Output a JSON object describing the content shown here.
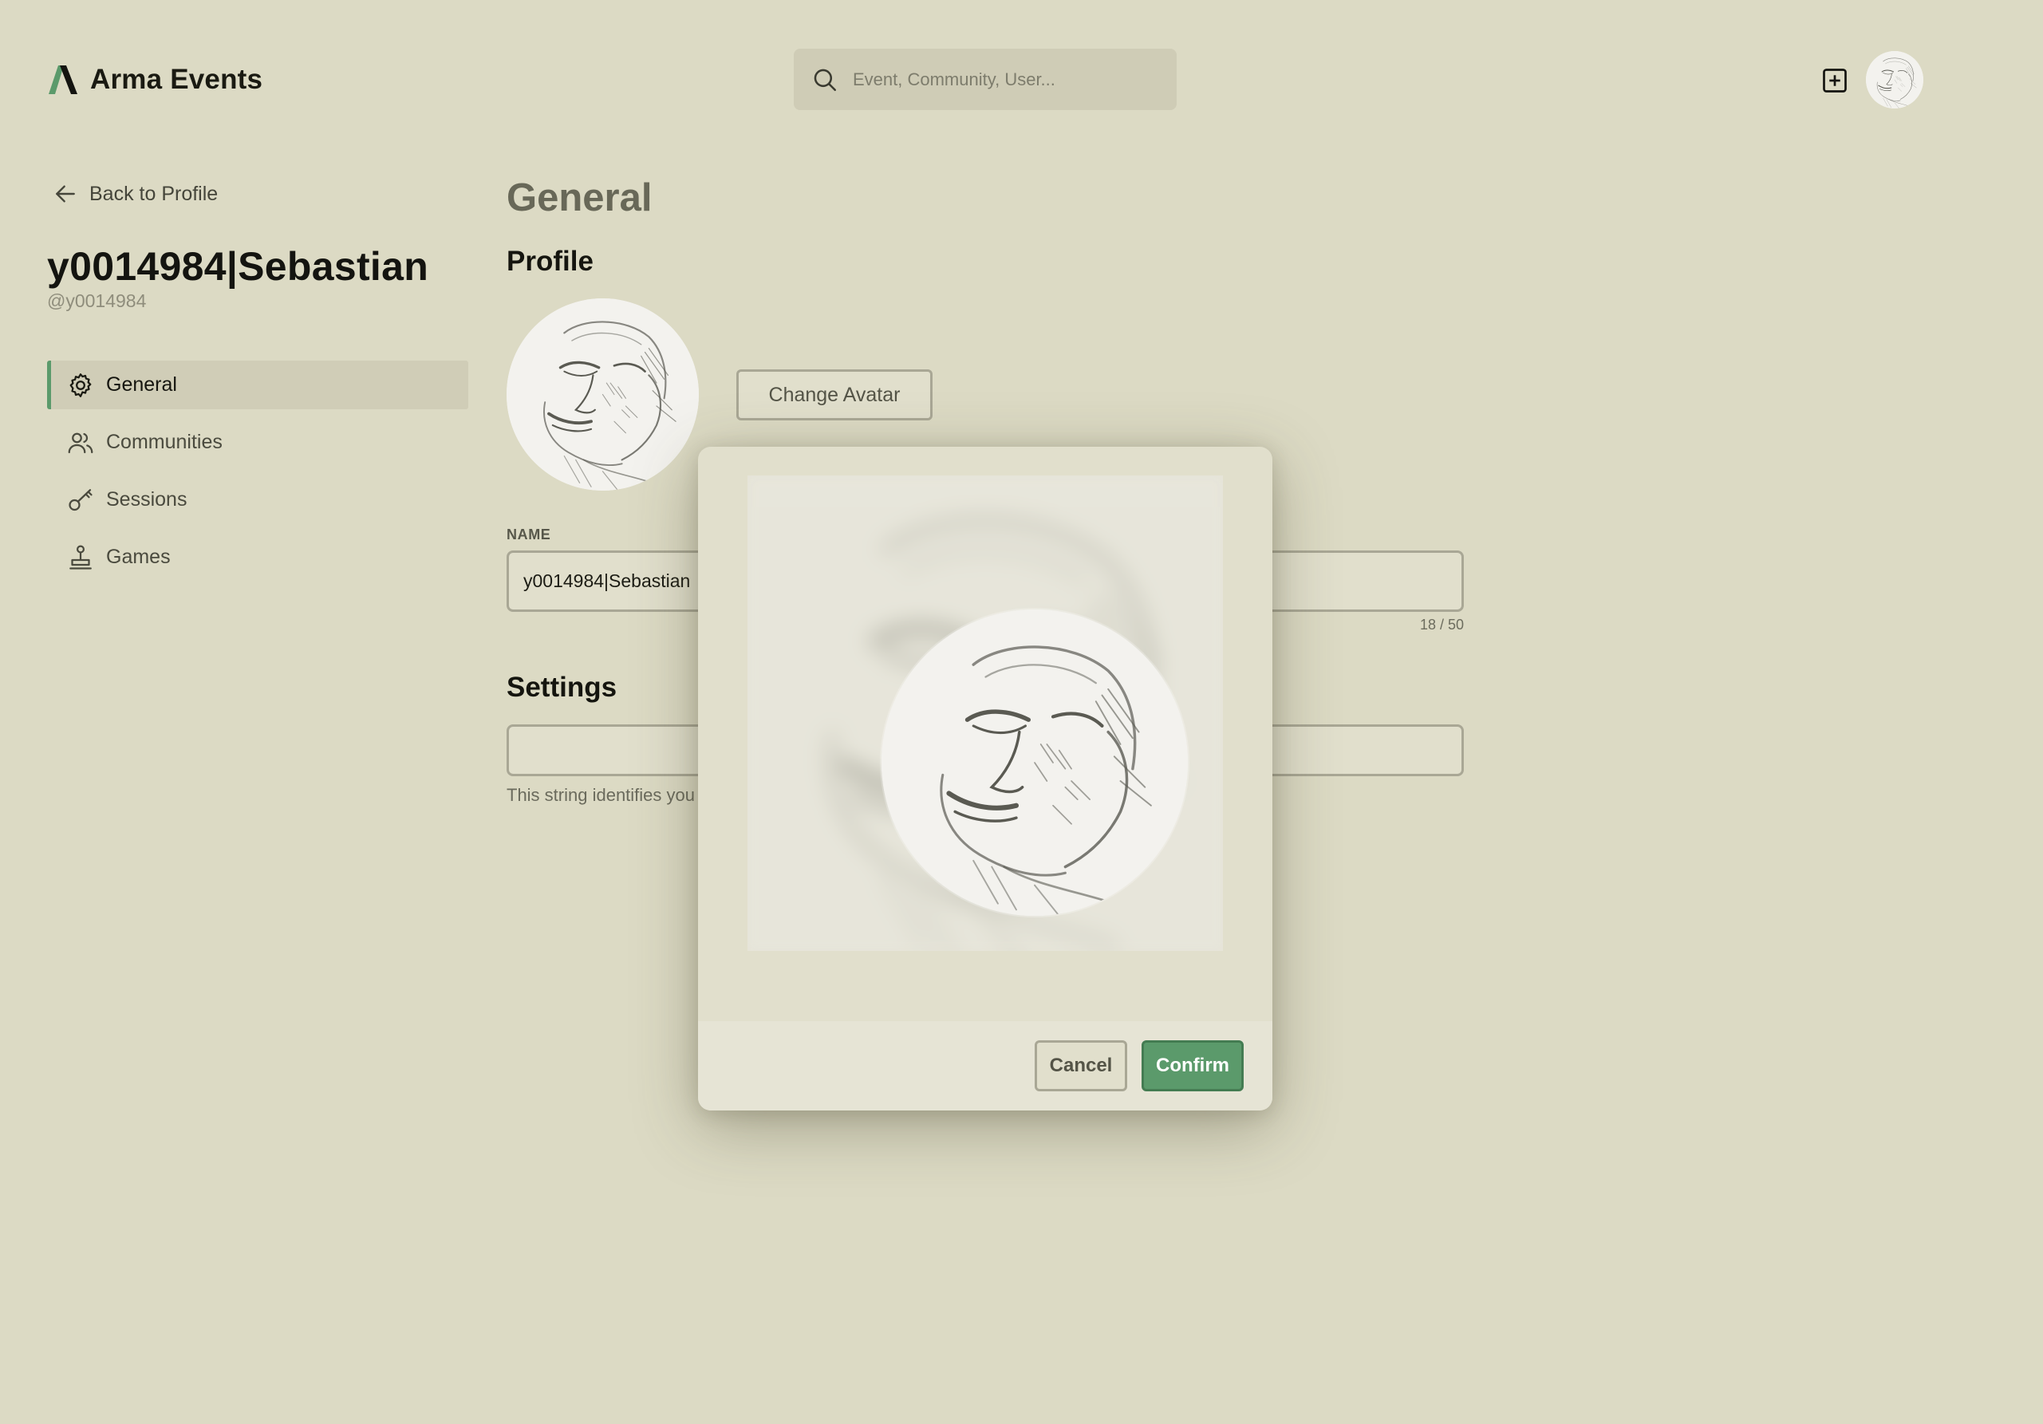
{
  "app": {
    "name": "Arma Events",
    "accent": "#5b9a6b"
  },
  "header": {
    "search_placeholder": "Event, Community, User..."
  },
  "sidebar": {
    "back_label": "Back to Profile",
    "username": "y0014984|Sebastian",
    "handle": "@y0014984",
    "items": [
      {
        "label": "General",
        "icon": "gear-icon",
        "active": true
      },
      {
        "label": "Communities",
        "icon": "users-icon",
        "active": false
      },
      {
        "label": "Sessions",
        "icon": "key-icon",
        "active": false
      },
      {
        "label": "Games",
        "icon": "joystick-icon",
        "active": false
      }
    ]
  },
  "main": {
    "title": "General",
    "profile_heading": "Profile",
    "change_avatar_label": "Change Avatar",
    "name_label": "NAME",
    "name_value": "y0014984|Sebastian",
    "name_counter": "18 / 50",
    "settings_heading": "Settings",
    "settings_value": "",
    "settings_helper": "This string identifies you"
  },
  "modal": {
    "cancel_label": "Cancel",
    "confirm_label": "Confirm"
  }
}
